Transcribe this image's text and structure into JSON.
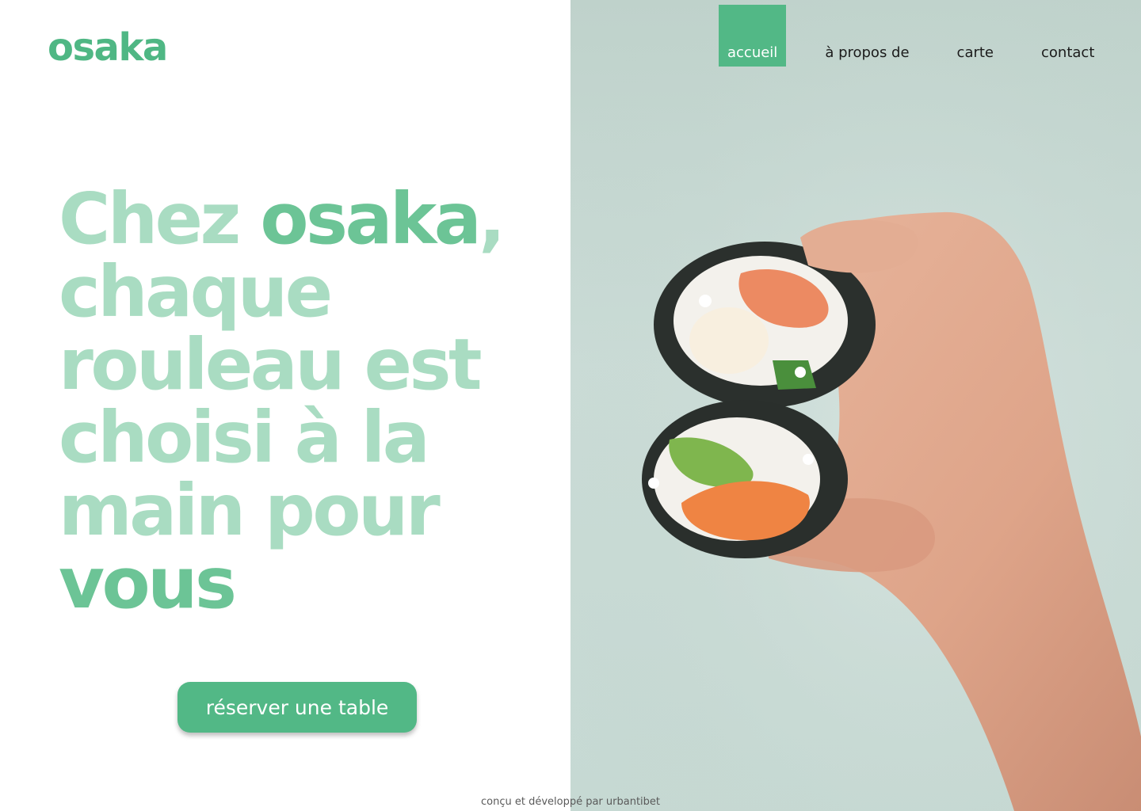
{
  "brand": {
    "logo": "osaka",
    "accent_color": "#52b886",
    "light_accent_color": "#a9dcc2"
  },
  "nav": {
    "items": [
      {
        "label": "accueil",
        "active": true
      },
      {
        "label": "à propos de",
        "active": false
      },
      {
        "label": "carte",
        "active": false
      },
      {
        "label": "contact",
        "active": false
      }
    ]
  },
  "hero": {
    "headline_part1": "Chez ",
    "headline_accent1": "osaka",
    "headline_part2": ", chaque rouleau est choisi à la main pour ",
    "headline_accent2": "vous",
    "cta_label": "réserver une table"
  },
  "footer": {
    "credit": "conçu et développé par  urbantibet"
  }
}
